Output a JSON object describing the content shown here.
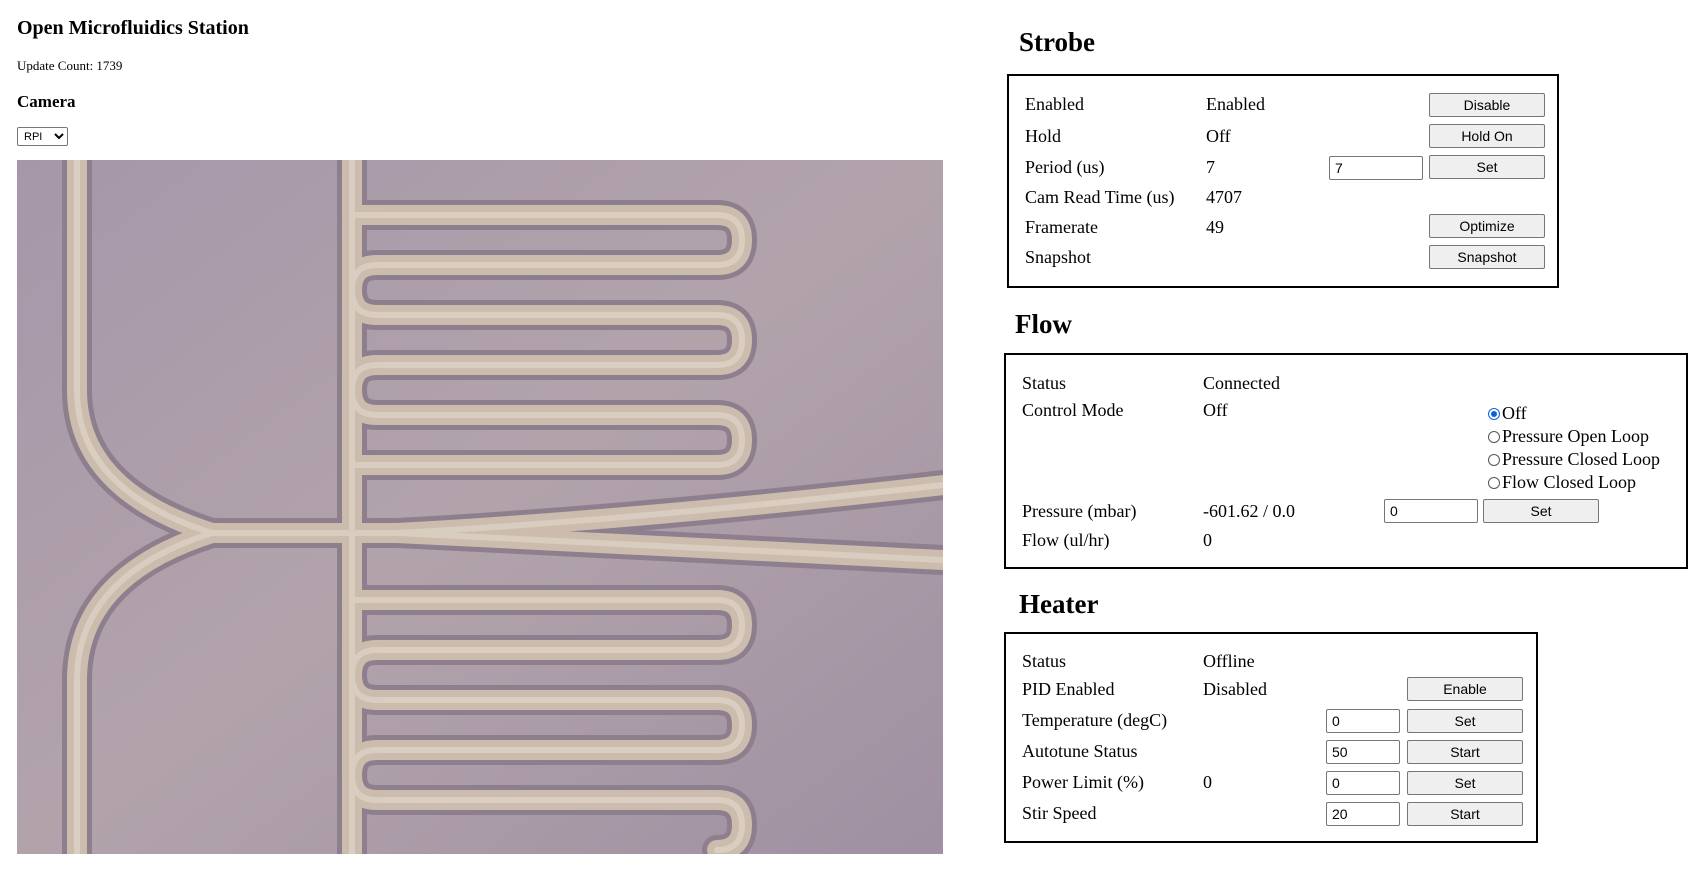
{
  "header": {
    "title": "Open Microfluidics Station",
    "update_count_label": "Update Count: 1739",
    "camera_heading": "Camera",
    "camera_select_value": "RPI",
    "camera_select_options": [
      "RPI"
    ]
  },
  "strobe": {
    "title": "Strobe",
    "rows": {
      "enabled": {
        "label": "Enabled",
        "value": "Enabled",
        "button": "Disable"
      },
      "hold": {
        "label": "Hold",
        "value": "Off",
        "button": "Hold On"
      },
      "period": {
        "label": "Period (us)",
        "value": "7",
        "input": "7",
        "button": "Set"
      },
      "cam_read": {
        "label": "Cam Read Time (us)",
        "value": "4707"
      },
      "framerate": {
        "label": "Framerate",
        "value": "49",
        "button": "Optimize"
      },
      "snapshot": {
        "label": "Snapshot",
        "button": "Snapshot"
      }
    }
  },
  "flow": {
    "title": "Flow",
    "status": {
      "label": "Status",
      "value": "Connected"
    },
    "control_mode": {
      "label": "Control Mode",
      "value": "Off"
    },
    "modes": [
      {
        "label": "Off",
        "selected": true
      },
      {
        "label": "Pressure Open Loop",
        "selected": false
      },
      {
        "label": "Pressure Closed Loop",
        "selected": false
      },
      {
        "label": "Flow Closed Loop",
        "selected": false
      }
    ],
    "pressure": {
      "label": "Pressure (mbar)",
      "value": "-601.62 / 0.0",
      "input": "0",
      "button": "Set"
    },
    "flow_rate": {
      "label": "Flow (ul/hr)",
      "value": "0"
    }
  },
  "heater": {
    "title": "Heater",
    "status": {
      "label": "Status",
      "value": "Offline"
    },
    "pid": {
      "label": "PID Enabled",
      "value": "Disabled",
      "button": "Enable"
    },
    "temperature": {
      "label": "Temperature (degC)",
      "input": "0",
      "button": "Set"
    },
    "autotune": {
      "label": "Autotune Status",
      "input": "50",
      "button": "Start"
    },
    "power_limit": {
      "label": "Power Limit (%)",
      "value": "0",
      "input": "0",
      "button": "Set"
    },
    "stir_speed": {
      "label": "Stir Speed",
      "input": "20",
      "button": "Start"
    }
  },
  "colors": {
    "radio_accent": "#0a64d8",
    "camera_background": "#a99aa8",
    "channel_fill": "#cbbcae"
  }
}
